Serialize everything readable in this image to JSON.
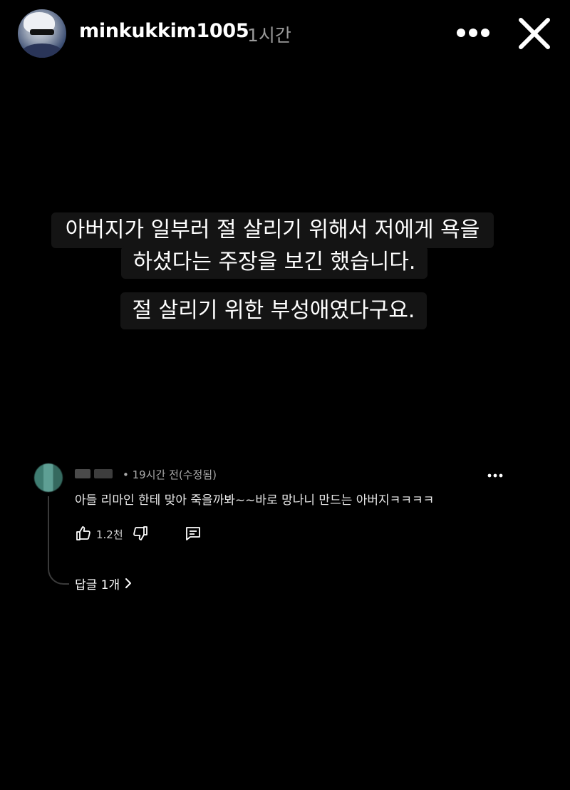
{
  "header": {
    "username": "minkukkim1005",
    "time_ago": "1시간"
  },
  "story": {
    "lines": [
      "아버지가 일부러 절 살리기 위해서 저에게 욕을",
      "하셨다는 주장을 보긴 했습니다.",
      "절 살리기 위한 부성애였다구요."
    ]
  },
  "comment": {
    "meta": "• 19시간 전(수정됨)",
    "text": "아들 리마인 한테 맞아 죽을까봐~~바로 망나니 만드는 아버지ㅋㅋㅋㅋ",
    "like_count": "1.2천",
    "replies_label": "답글 1개"
  },
  "colors": {
    "background": "#000000",
    "caption_bg": "#141414",
    "muted_text": "#9a9a9a"
  },
  "icons": {
    "more": "more-horizontal-icon",
    "close": "close-icon",
    "like": "thumbs-up-icon",
    "dislike": "thumbs-down-icon",
    "reply": "comment-icon",
    "chevron": "chevron-right-icon"
  }
}
